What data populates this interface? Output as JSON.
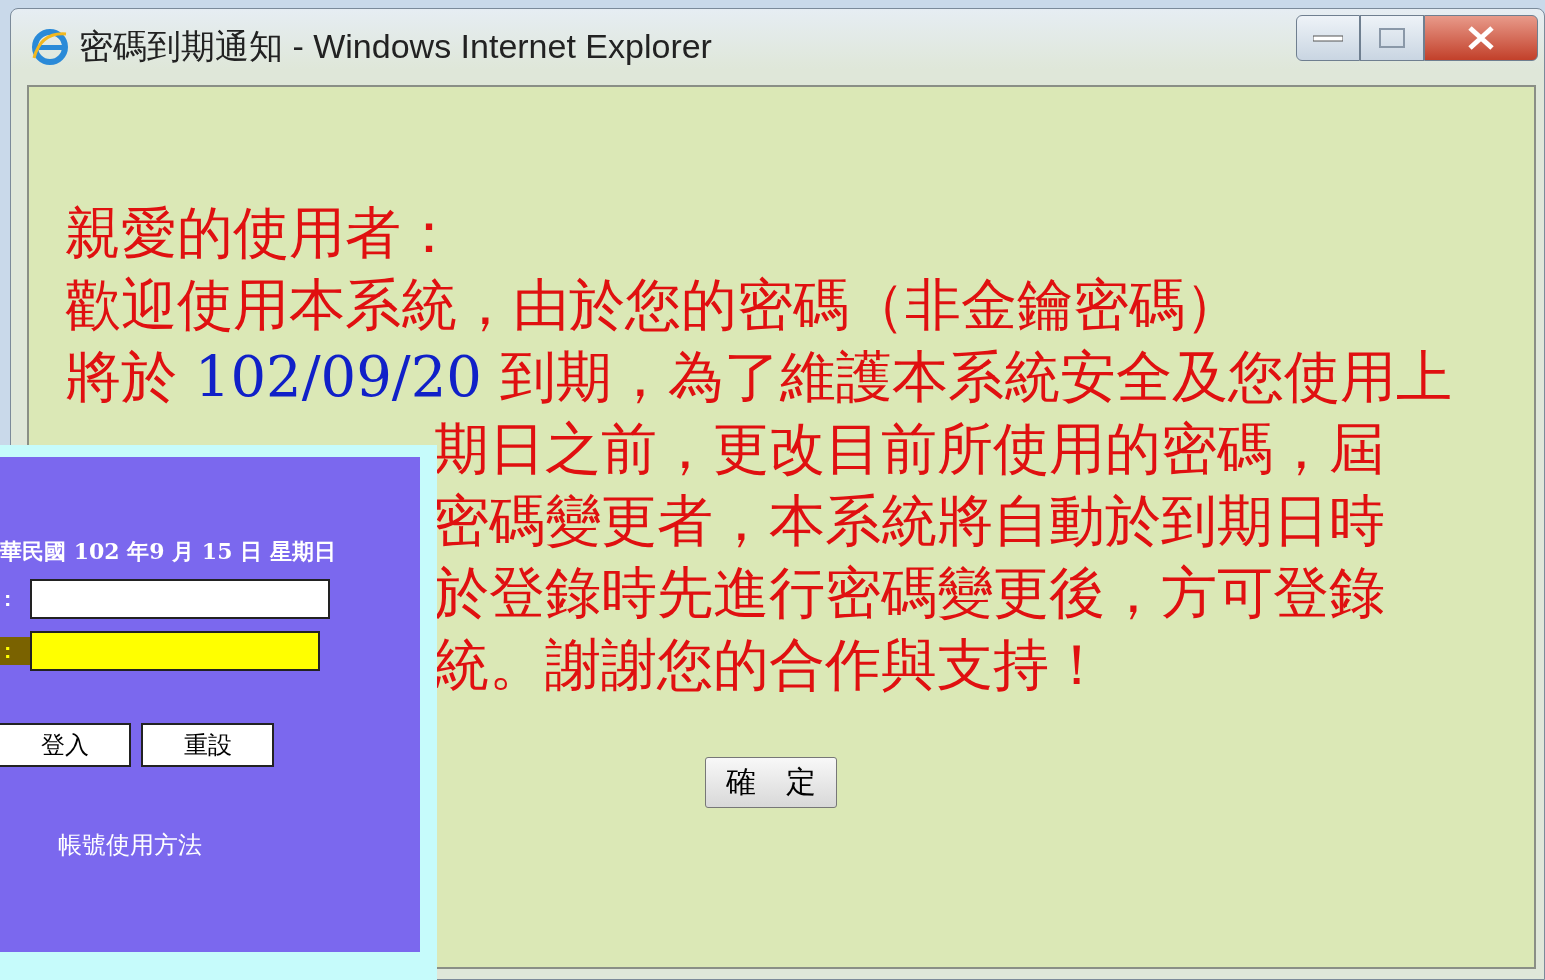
{
  "window": {
    "title": "密碼到期通知 - Windows Internet Explorer"
  },
  "message": {
    "greeting": "親愛的使用者：",
    "line_2": "歡迎使用本系統，由於您的密碼（非金鑰密碼）",
    "line_3": {
      "prefix": "將於",
      "date": "102/09/20",
      "suffix": "到期，為了維護本系統安全及您使用上"
    },
    "visible_lines": [
      "期日之前，更改目前所使用的密碼，屆",
      "密碼變更者，本系統將自動於到期日時",
      "於登錄時先進行密碼變更後，方可登錄",
      "統。謝謝您的合作與支持！"
    ],
    "button": "確　定"
  },
  "login_panel": {
    "date_text": "華民國 102 年9 月 15 日 星期日",
    "fields": [
      {
        "label": ":",
        "highlighted": false
      },
      {
        "label": ":",
        "highlighted": true
      }
    ],
    "buttons": [
      "登入",
      "重設"
    ],
    "link": "帳號使用方法"
  }
}
